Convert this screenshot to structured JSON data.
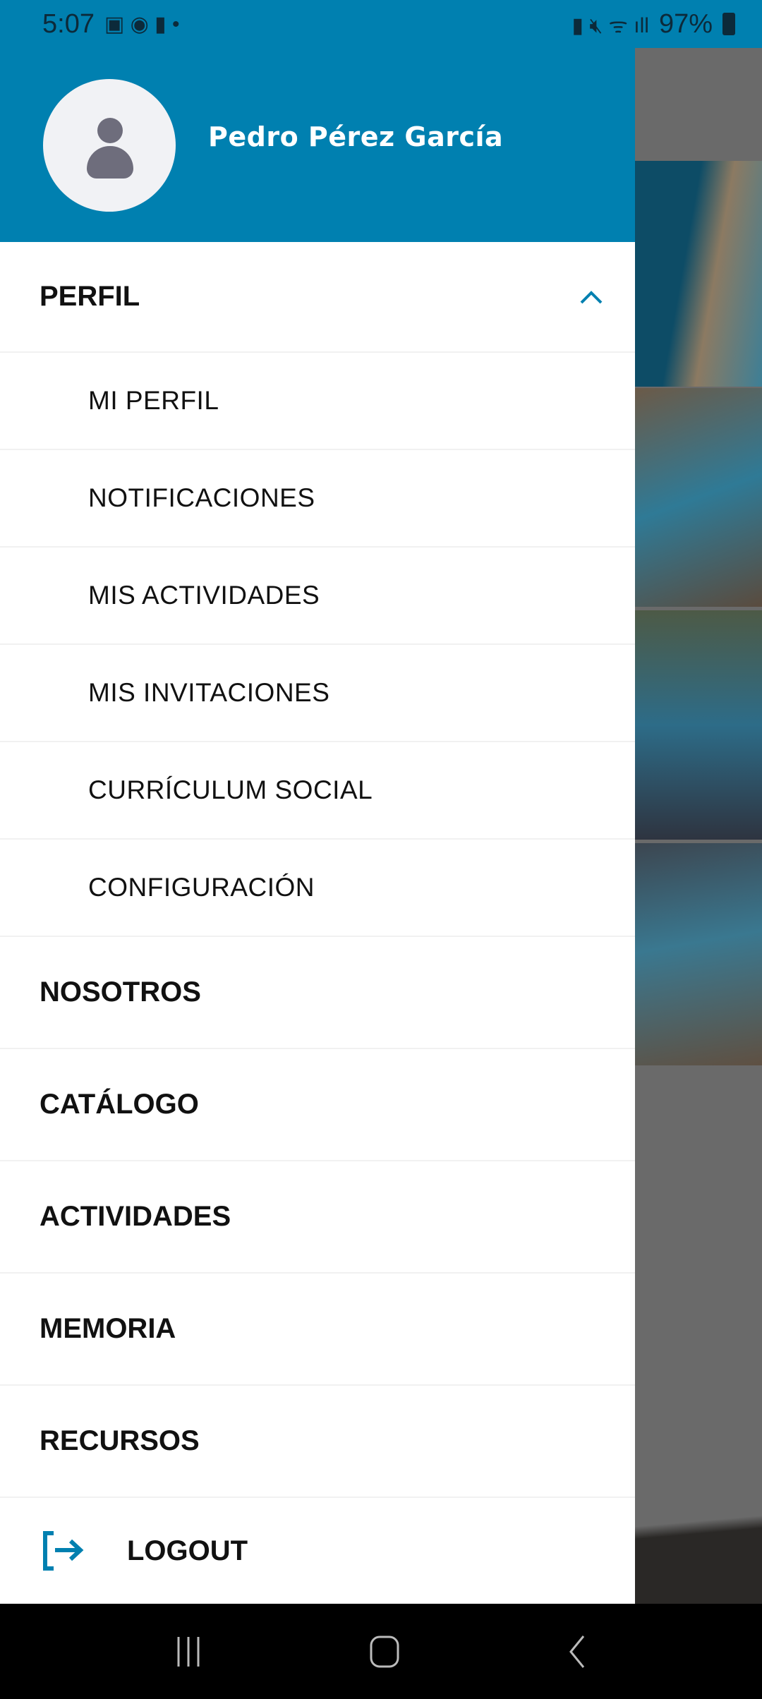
{
  "status_bar": {
    "time": "5:07",
    "battery": "97%"
  },
  "user": {
    "name": "Pedro Pérez García"
  },
  "menu": {
    "perfil": "PERFIL",
    "sub_items": [
      "MI PERFIL",
      "NOTIFICACIONES",
      "MIS ACTIVIDADES",
      "MIS INVITACIONES",
      "CURRÍCULUM SOCIAL",
      "CONFIGURACIÓN"
    ],
    "items": [
      "NOSOTROS",
      "CATÁLOGO",
      "ACTIVIDADES",
      "MEMORIA",
      "RECURSOS"
    ],
    "logout": "LOGOUT"
  },
  "colors": {
    "brand": "#0080b0"
  }
}
